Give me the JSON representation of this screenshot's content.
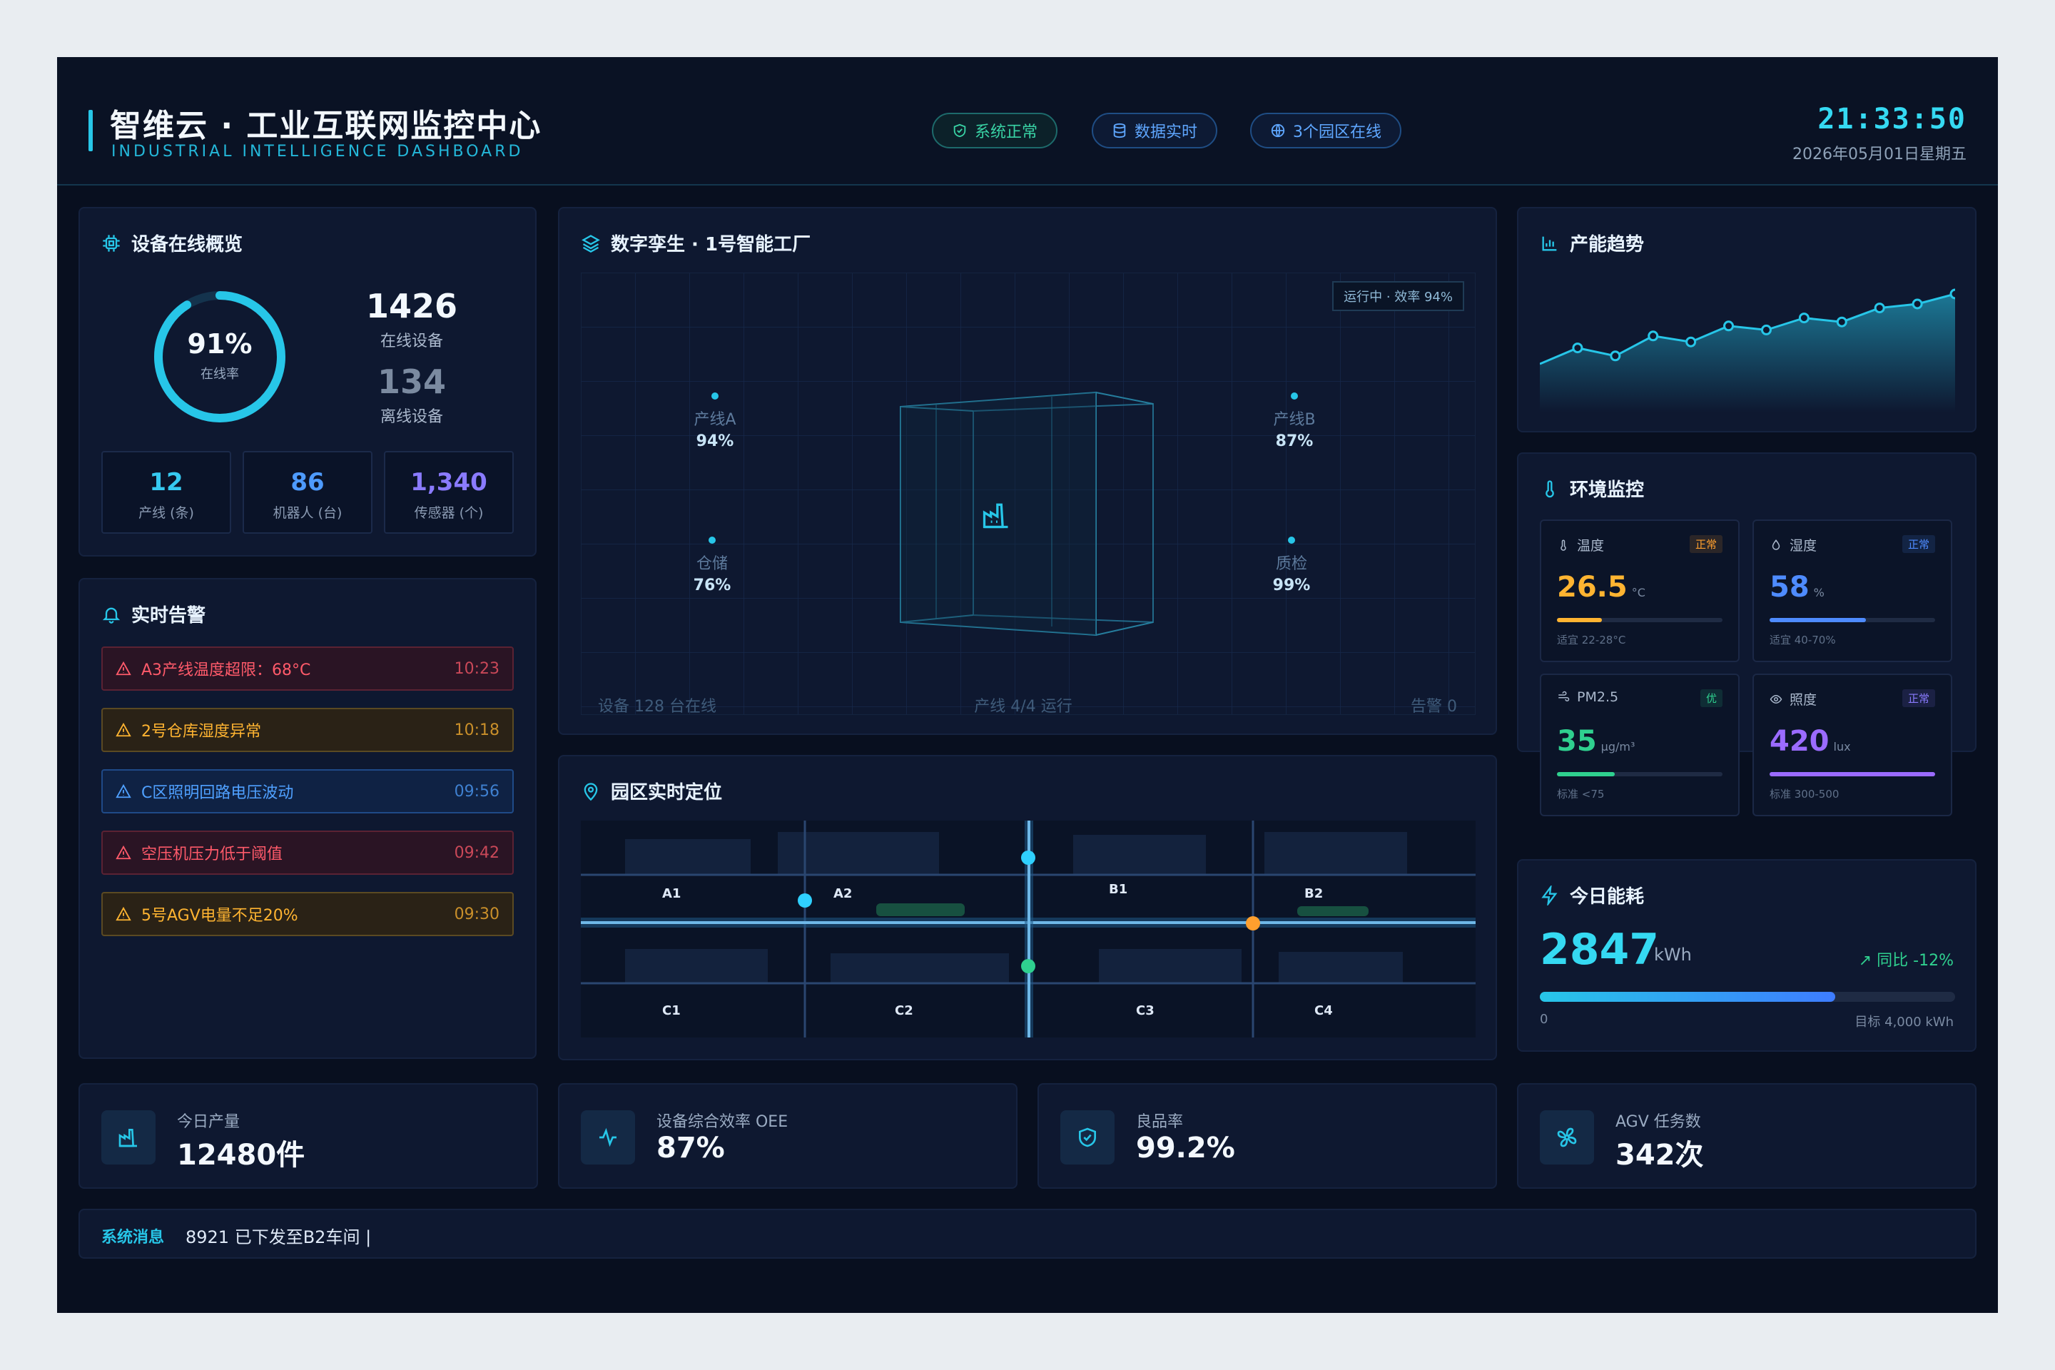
{
  "header": {
    "title": "智维云 · 工业互联网监控中心",
    "subtitle": "INDUSTRIAL INTELLIGENCE DASHBOARD",
    "pills": [
      {
        "label": "系统正常",
        "icon": "shield-check-icon"
      },
      {
        "label": "数据实时",
        "icon": "database-icon"
      },
      {
        "label": "3个园区在线",
        "icon": "globe-icon"
      }
    ],
    "time": "21:33:50",
    "date": "2026年05月01日星期五"
  },
  "devices": {
    "title": "设备在线概览",
    "rate": "91%",
    "rate_value": 0.91,
    "rate_label": "在线率",
    "online_value": "1426",
    "online_label": "在线设备",
    "offline_value": "134",
    "offline_label": "离线设备",
    "stats": [
      {
        "value": "12",
        "label": "产线 (条)",
        "color": "#36c9f0"
      },
      {
        "value": "86",
        "label": "机器人 (台)",
        "color": "#4e9bff"
      },
      {
        "value": "1,340",
        "label": "传感器 (个)",
        "color": "#8a7bff"
      }
    ]
  },
  "alerts": {
    "title": "实时告警",
    "items": [
      {
        "text": "A3产线温度超限：68°C",
        "time": "10:23",
        "level": "red"
      },
      {
        "text": "2号仓库湿度异常",
        "time": "10:18",
        "level": "yel"
      },
      {
        "text": "C区照明回路电压波动",
        "time": "09:56",
        "level": "blu"
      },
      {
        "text": "空压机压力低于阈值",
        "time": "09:42",
        "level": "red"
      },
      {
        "text": "5号AGV电量不足20%",
        "time": "09:30",
        "level": "yel"
      }
    ]
  },
  "twin": {
    "title": "数字孪生 · 1号智能工厂",
    "status": "运行中 · 效率 94%",
    "nodes": [
      {
        "name": "产线A",
        "value": "94%"
      },
      {
        "name": "产线B",
        "value": "87%"
      },
      {
        "name": "仓储",
        "value": "76%"
      },
      {
        "name": "质检",
        "value": "99%"
      }
    ],
    "footer_left": "设备 128 台在线",
    "footer_mid": "产线 4/4 运行",
    "footer_right": "告警 0"
  },
  "location": {
    "title": "园区实时定位",
    "zones": [
      "A1",
      "A2",
      "B1",
      "B2",
      "C1",
      "C2",
      "C3",
      "C4"
    ]
  },
  "trend": {
    "title": "产能趋势"
  },
  "chart_data": {
    "type": "area",
    "values": [
      30,
      38,
      34,
      44,
      41,
      49,
      47,
      53,
      51,
      58,
      60,
      65
    ],
    "color": "#27c6e8"
  },
  "env": {
    "title": "环境监控",
    "cards": [
      {
        "name": "温度",
        "tag": "正常",
        "value": "26.5",
        "unit": "°C",
        "note": "适宜 22-28°C",
        "fill": 0.27,
        "color": "#ffb431",
        "tag_color": "#ff9f2e",
        "icon": "thermometer-icon"
      },
      {
        "name": "湿度",
        "tag": "正常",
        "value": "58",
        "unit": "%",
        "note": "适宜 40-70%",
        "fill": 0.58,
        "color": "#4e8bff",
        "tag_color": "#4e8bff",
        "icon": "droplets-icon"
      },
      {
        "name": "PM2.5",
        "tag": "优",
        "value": "35",
        "unit": "μg/m³",
        "note": "标准 <75",
        "fill": 0.35,
        "color": "#2fd08f",
        "tag_color": "#2fd08f",
        "icon": "wind-icon"
      },
      {
        "name": "照度",
        "tag": "正常",
        "value": "420",
        "unit": "lux",
        "note": "标准 300-500",
        "fill": 1.0,
        "color": "#9b6bff",
        "tag_color": "#8a7bff",
        "icon": "eye-icon"
      }
    ]
  },
  "energy": {
    "title": "今日能耗",
    "value": "2847",
    "unit": "kWh",
    "yoy": "同比 -12%",
    "progress": 0.712,
    "min_label": "0",
    "target_label": "目标 4,000 kWh"
  },
  "kpis": [
    {
      "label": "今日产量",
      "value": "12480件",
      "icon": "factory-icon"
    },
    {
      "label": "设备综合效率 OEE",
      "value": "87%",
      "icon": "activity-icon"
    },
    {
      "label": "良品率",
      "value": "99.2%",
      "icon": "shield-check-icon"
    },
    {
      "label": "AGV 任务数",
      "value": "342次",
      "icon": "fan-icon"
    }
  ],
  "ticker": {
    "label": "系统消息",
    "text": "8921 已下发至B2车间 |"
  }
}
